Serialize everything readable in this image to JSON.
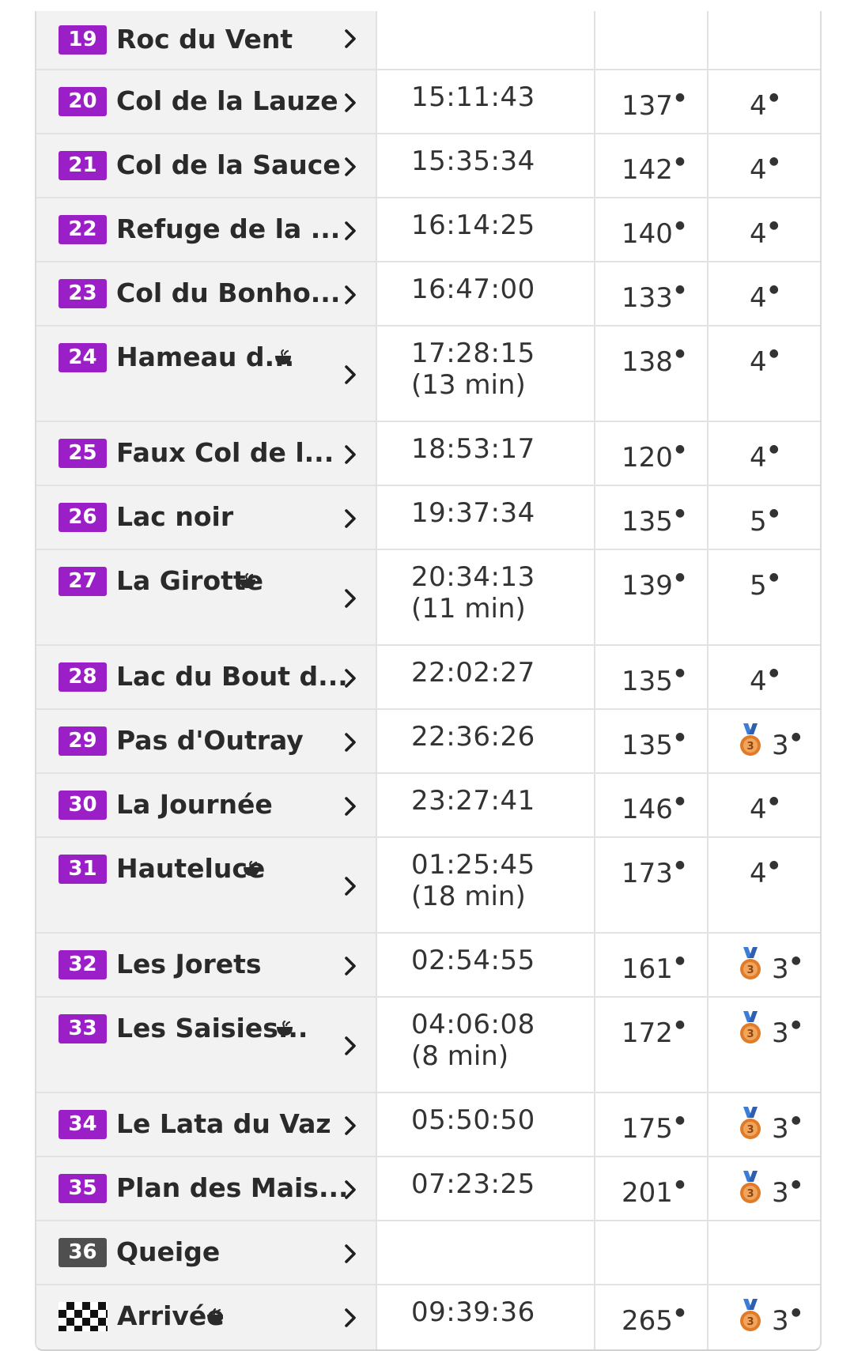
{
  "colors": {
    "badge_purple": "#9b1fc7",
    "badge_grey": "#4f4f4f",
    "medal": "#e07b2a"
  },
  "rows": [
    {
      "num": "19",
      "name": "Roc du Vent",
      "time": "",
      "sub": "",
      "rank": "",
      "cat": "",
      "cup": false,
      "medal": false,
      "badge": "purple"
    },
    {
      "num": "20",
      "name": "Col de la Lauze",
      "time": "15:11:43",
      "sub": "",
      "rank": "137",
      "cat": "4",
      "cup": false,
      "medal": false,
      "badge": "purple"
    },
    {
      "num": "21",
      "name": "Col de la Sauce",
      "time": "15:35:34",
      "sub": "",
      "rank": "142",
      "cat": "4",
      "cup": false,
      "medal": false,
      "badge": "purple"
    },
    {
      "num": "22",
      "name": "Refuge de la ...",
      "time": "16:14:25",
      "sub": "",
      "rank": "140",
      "cat": "4",
      "cup": false,
      "medal": false,
      "badge": "purple"
    },
    {
      "num": "23",
      "name": "Col du Bonho...",
      "time": "16:47:00",
      "sub": "",
      "rank": "133",
      "cat": "4",
      "cup": false,
      "medal": false,
      "badge": "purple"
    },
    {
      "num": "24",
      "name": "Hameau d...",
      "time": "17:28:15",
      "sub": "(13 min)",
      "rank": "138",
      "cat": "4",
      "cup": true,
      "medal": false,
      "badge": "purple"
    },
    {
      "num": "25",
      "name": "Faux Col de l...",
      "time": "18:53:17",
      "sub": "",
      "rank": "120",
      "cat": "4",
      "cup": false,
      "medal": false,
      "badge": "purple"
    },
    {
      "num": "26",
      "name": "Lac noir",
      "time": "19:37:34",
      "sub": "",
      "rank": "135",
      "cat": "5",
      "cup": false,
      "medal": false,
      "badge": "purple"
    },
    {
      "num": "27",
      "name": "La Girotte",
      "time": "20:34:13",
      "sub": "(11 min)",
      "rank": "139",
      "cat": "5",
      "cup": true,
      "medal": false,
      "badge": "purple"
    },
    {
      "num": "28",
      "name": "Lac du Bout d...",
      "time": "22:02:27",
      "sub": "",
      "rank": "135",
      "cat": "4",
      "cup": false,
      "medal": false,
      "badge": "purple"
    },
    {
      "num": "29",
      "name": "Pas d'Outray",
      "time": "22:36:26",
      "sub": "",
      "rank": "135",
      "cat": "3",
      "cup": false,
      "medal": true,
      "badge": "purple"
    },
    {
      "num": "30",
      "name": "La Journée",
      "time": "23:27:41",
      "sub": "",
      "rank": "146",
      "cat": "4",
      "cup": false,
      "medal": false,
      "badge": "purple"
    },
    {
      "num": "31",
      "name": "Hauteluce",
      "time": "01:25:45",
      "sub": "(18 min)",
      "rank": "173",
      "cat": "4",
      "cup": true,
      "medal": false,
      "badge": "purple"
    },
    {
      "num": "32",
      "name": "Les Jorets",
      "time": "02:54:55",
      "sub": "",
      "rank": "161",
      "cat": "3",
      "cup": false,
      "medal": true,
      "badge": "purple"
    },
    {
      "num": "33",
      "name": "Les Saisies...",
      "time": "04:06:08",
      "sub": "(8 min)",
      "rank": "172",
      "cat": "3",
      "cup": true,
      "medal": true,
      "badge": "purple"
    },
    {
      "num": "34",
      "name": "Le Lata du Vaz",
      "time": "05:50:50",
      "sub": "",
      "rank": "175",
      "cat": "3",
      "cup": false,
      "medal": true,
      "badge": "purple"
    },
    {
      "num": "35",
      "name": "Plan des Mais...",
      "time": "07:23:25",
      "sub": "",
      "rank": "201",
      "cat": "3",
      "cup": false,
      "medal": true,
      "badge": "purple"
    },
    {
      "num": "36",
      "name": "Queige",
      "time": "",
      "sub": "",
      "rank": "",
      "cat": "",
      "cup": false,
      "medal": false,
      "badge": "grey"
    },
    {
      "num": "",
      "name": "Arrivée",
      "time": "09:39:36",
      "sub": "",
      "rank": "265",
      "cat": "3",
      "cup": true,
      "medal": true,
      "badge": "flag"
    }
  ]
}
